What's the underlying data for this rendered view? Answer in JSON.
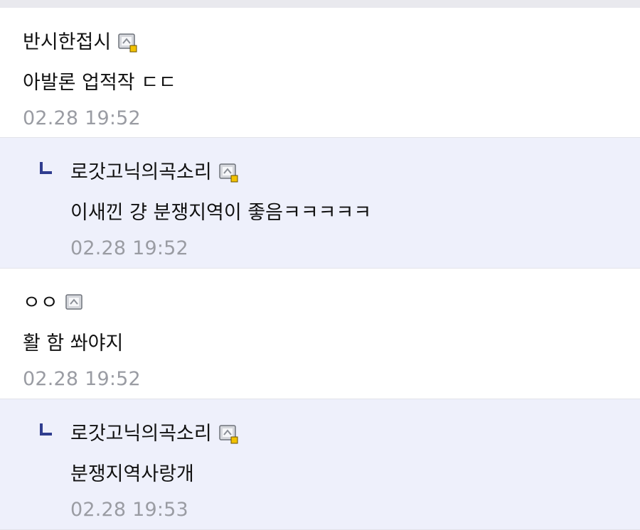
{
  "comments": [
    {
      "type": "top",
      "username": "반시한접시",
      "icon": "gallog-icon-badge",
      "text": "아발론 업적작 ㄷㄷ",
      "time": "02.28 19:52"
    },
    {
      "type": "reply",
      "username": "로갓고닉의곡소리",
      "icon": "gallog-icon-badge",
      "text": "이새낀 걍 분쟁지역이 좋음ㅋㅋㅋㅋㅋ",
      "time": "02.28 19:52"
    },
    {
      "type": "top",
      "username": "ㅇㅇ",
      "icon": "gallog-icon",
      "text": "활 함 쏴야지",
      "time": "02.28 19:52"
    },
    {
      "type": "reply",
      "username": "로갓고닉의곡소리",
      "icon": "gallog-icon-badge",
      "text": "분쟁지역사랑개",
      "time": "02.28 19:53"
    }
  ],
  "colors": {
    "reply_bg": "#eef0fb",
    "time": "#9a9ca3",
    "reply_mark": "#2f3d8f",
    "badge": "#f2c200"
  }
}
